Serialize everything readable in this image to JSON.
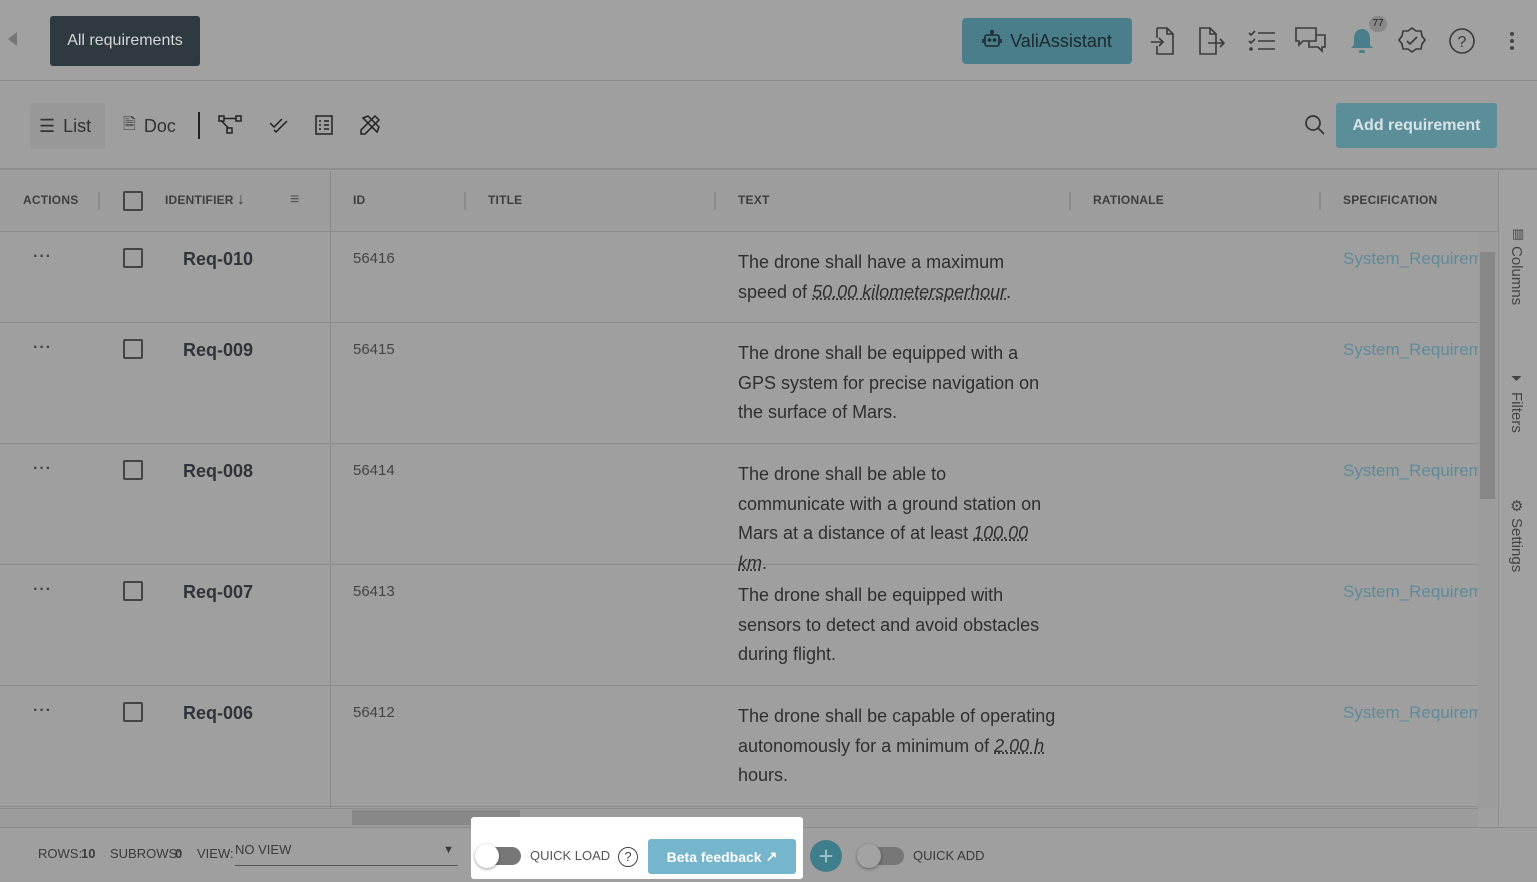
{
  "header": {
    "all_requirements": "All requirements",
    "vali_assistant": "ValiAssistant",
    "notification_count": "77"
  },
  "toolbar": {
    "list": "List",
    "doc": "Doc",
    "add_requirement": "Add requirement"
  },
  "columns": {
    "actions": "ACTIONS",
    "identifier": "IDENTIFIER",
    "id": "ID",
    "title": "TITLE",
    "text": "TEXT",
    "rationale": "RATIONALE",
    "specification": "SPECIFICATION"
  },
  "rows": [
    {
      "identifier": "Req-010",
      "id": "56416",
      "text_before": "The drone shall have a maximum speed of ",
      "value": "50.00 kilometersperhour",
      "text_after": ".",
      "specification": "System_Requirements"
    },
    {
      "identifier": "Req-009",
      "id": "56415",
      "text_before": "The drone shall be equipped with a GPS system for precise navigation on the surface of Mars.",
      "value": "",
      "text_after": "",
      "specification": "System_Requirements"
    },
    {
      "identifier": "Req-008",
      "id": "56414",
      "text_before": "The drone shall be able to communicate with a ground station on Mars at a distance of at least ",
      "value": "100.00 km",
      "text_after": ".",
      "specification": "System_Requirements"
    },
    {
      "identifier": "Req-007",
      "id": "56413",
      "text_before": "The drone shall be equipped with sensors to detect and avoid obstacles during flight.",
      "value": "",
      "text_after": "",
      "specification": "System_Requirements"
    },
    {
      "identifier": "Req-006",
      "id": "56412",
      "text_before": "The drone shall be capable of operating autonomously for a minimum of ",
      "value": "2.00 h",
      "text_after": " hours.",
      "specification": "System_Requirements"
    }
  ],
  "side_panel": {
    "columns": "Columns",
    "filters": "Filters",
    "settings": "Settings"
  },
  "footer": {
    "rows_label": "ROWS:",
    "rows": "10",
    "subrows_label": "SUBROWS:",
    "subrows": "0",
    "view_label": "VIEW:",
    "view": "NO VIEW",
    "quick_load": "QUICK LOAD",
    "beta_feedback": "Beta feedback",
    "quick_add": "QUICK ADD"
  }
}
